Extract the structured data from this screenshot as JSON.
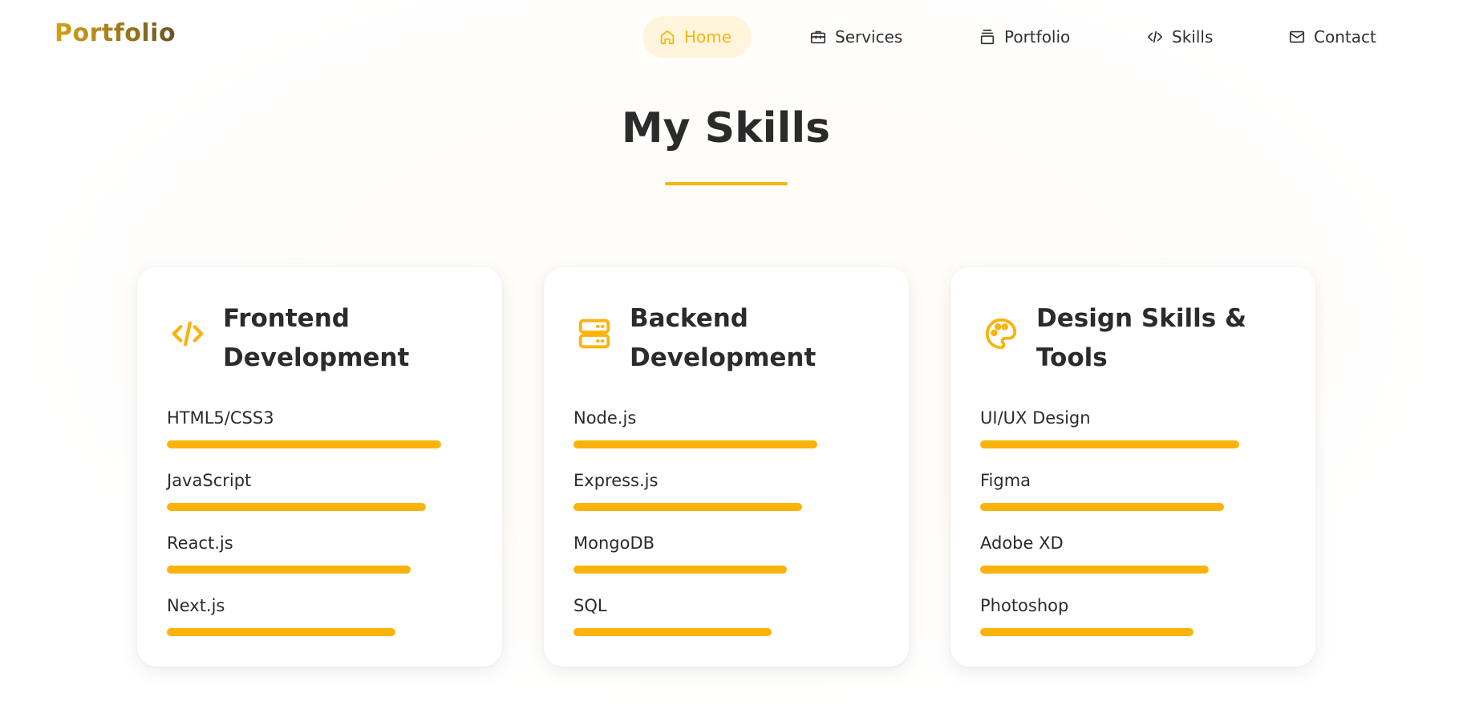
{
  "header": {
    "logo": "Portfolio",
    "nav": [
      {
        "label": "Home",
        "icon": "home-icon",
        "active": true
      },
      {
        "label": "Services",
        "icon": "briefcase-icon",
        "active": false
      },
      {
        "label": "Portfolio",
        "icon": "layers-icon",
        "active": false
      },
      {
        "label": "Skills",
        "icon": "code-icon",
        "active": false
      },
      {
        "label": "Contact",
        "icon": "mail-icon",
        "active": false
      }
    ]
  },
  "main": {
    "title": "My Skills",
    "cards": [
      {
        "title": "Frontend Development",
        "icon": "code-icon",
        "skills": [
          {
            "name": "HTML5/CSS3",
            "level": 0.9
          },
          {
            "name": "JavaScript",
            "level": 0.85
          },
          {
            "name": "React.js",
            "level": 0.8
          },
          {
            "name": "Next.js",
            "level": 0.75
          }
        ]
      },
      {
        "title": "Backend Development",
        "icon": "server-icon",
        "skills": [
          {
            "name": "Node.js",
            "level": 0.8
          },
          {
            "name": "Express.js",
            "level": 0.75
          },
          {
            "name": "MongoDB",
            "level": 0.7
          },
          {
            "name": "SQL",
            "level": 0.65
          }
        ]
      },
      {
        "title": "Design Skills & Tools",
        "icon": "palette-icon",
        "skills": [
          {
            "name": "UI/UX Design",
            "level": 0.85
          },
          {
            "name": "Figma",
            "level": 0.8
          },
          {
            "name": "Adobe XD",
            "level": 0.75
          },
          {
            "name": "Photoshop",
            "level": 0.7
          }
        ]
      }
    ]
  },
  "colors": {
    "accent": "#fbb30c",
    "active_nav_bg": "#fff5dc",
    "text": "#2b2b2b"
  }
}
